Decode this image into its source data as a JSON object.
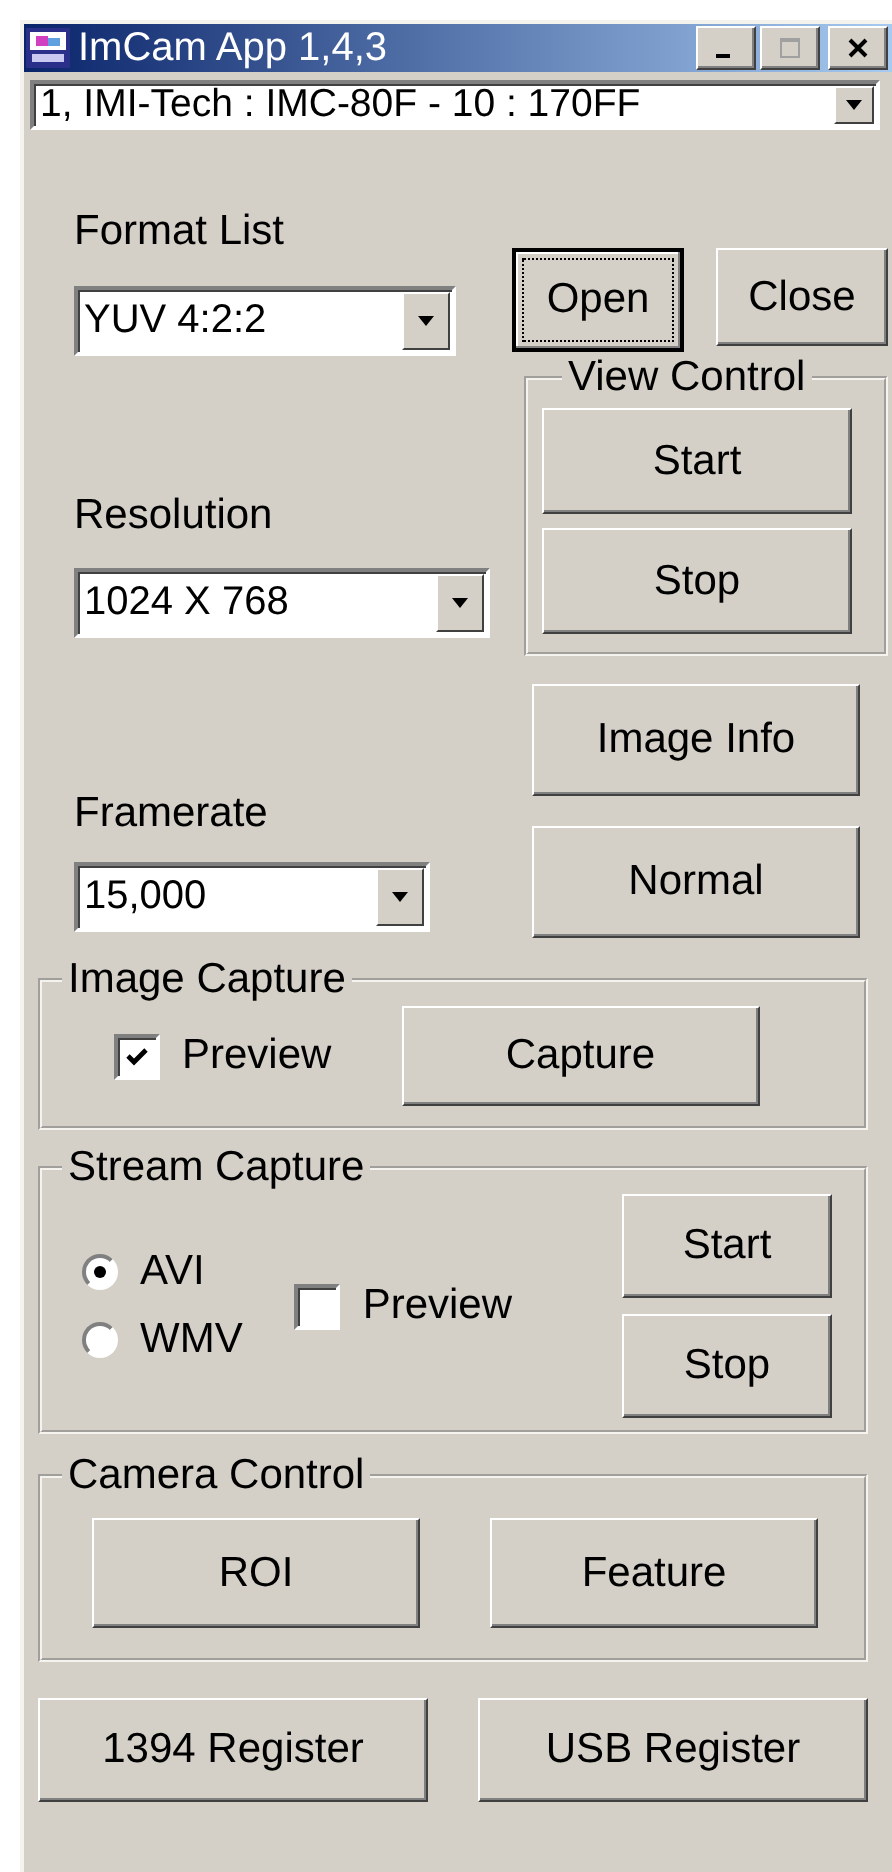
{
  "window": {
    "title": "ImCam App 1,4,3"
  },
  "device": {
    "value": "1, IMI-Tech : IMC-80F - 10 : 170FF"
  },
  "format_list": {
    "label": "Format List",
    "value": "YUV 4:2:2"
  },
  "top_buttons": [
    {
      "label": "Open",
      "focused": true
    },
    {
      "label": "Close",
      "focused": false
    }
  ],
  "view_control": {
    "title": "View Control",
    "buttons": [
      "Start",
      "Stop"
    ]
  },
  "resolution": {
    "label": "Resolution",
    "value": "1024 X 768"
  },
  "image_info_button": "Image Info",
  "normal_button": "Normal",
  "framerate": {
    "label": "Framerate",
    "value": "15,000"
  },
  "image_capture": {
    "title": "Image Capture",
    "preview": {
      "label": "Preview",
      "checked": true
    },
    "button": "Capture"
  },
  "stream_capture": {
    "title": "Stream Capture",
    "formats": [
      {
        "label": "AVI",
        "selected": true
      },
      {
        "label": "WMV",
        "selected": false
      }
    ],
    "preview": {
      "label": "Preview",
      "checked": false
    },
    "buttons": [
      "Start",
      "Stop"
    ]
  },
  "camera_control": {
    "title": "Camera Control",
    "buttons": [
      "ROI",
      "Feature"
    ]
  },
  "bottom_buttons": [
    "1394 Register",
    "USB Register"
  ]
}
